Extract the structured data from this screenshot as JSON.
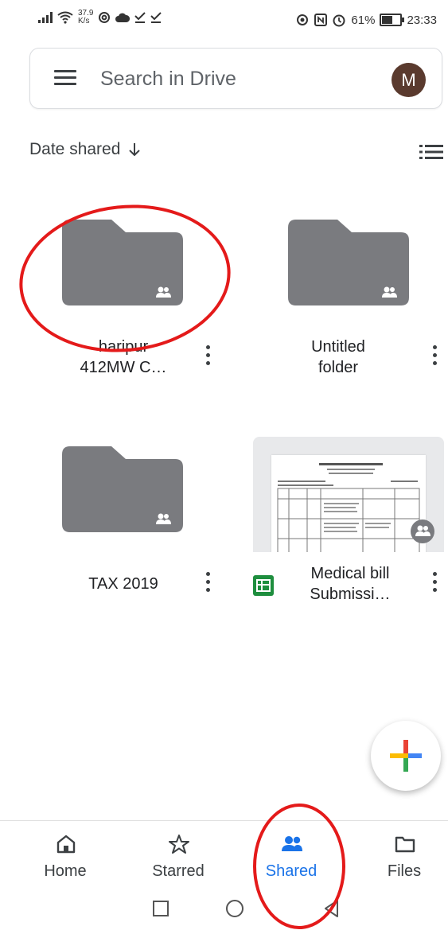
{
  "status_bar": {
    "speed_value": "37.9",
    "speed_unit": "K/s",
    "battery_percent": "61%",
    "time": "23:33",
    "battery_level": 0.61
  },
  "search": {
    "placeholder": "Search in Drive",
    "avatar_letter": "M"
  },
  "sort": {
    "label": "Date shared",
    "direction_icon": "arrow-down-icon"
  },
  "items": [
    {
      "type": "folder",
      "name_line1": "haripur",
      "name_line2": "412MW C…",
      "shared": true
    },
    {
      "type": "folder",
      "name_line1": "Untitled",
      "name_line2": "folder",
      "shared": true
    },
    {
      "type": "folder",
      "name_line1": "TAX 2019",
      "shared": true
    },
    {
      "type": "spreadsheet",
      "name_line1": "Medical bill",
      "name_line2": "Submissi…",
      "shared": true
    }
  ],
  "bottom_nav": [
    {
      "label": "Home",
      "icon": "home-icon",
      "active": false
    },
    {
      "label": "Starred",
      "icon": "star-icon",
      "active": false
    },
    {
      "label": "Shared",
      "icon": "people-icon",
      "active": true
    },
    {
      "label": "Files",
      "icon": "folder-icon",
      "active": false
    }
  ],
  "colors": {
    "accent": "#1a73e8",
    "folder_gray": "#7a7b7f",
    "annotation_red": "#e41a1a",
    "sheets_green": "#1e8e3e"
  }
}
